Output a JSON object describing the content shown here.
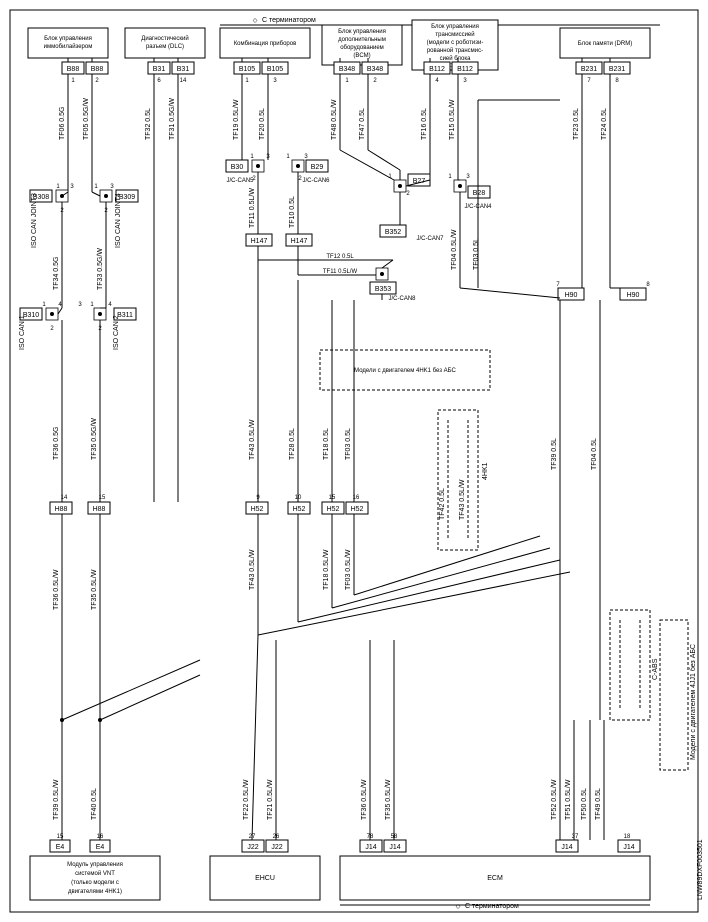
{
  "title_top": "С терминатором",
  "title_bottom": "С терминатором",
  "doc_id": "LNW89DXF003501",
  "blocks": {
    "immobilizer": {
      "line1": "Блок управления",
      "line2": "иммобилайзером"
    },
    "diag_socket": {
      "line1": "Диагностический",
      "line2": "разъем (DLC)"
    },
    "instrument": {
      "line1": "Комбинация приборов"
    },
    "bcm": {
      "line1": "Блок управления",
      "line2": "дополнительным",
      "line3": "оборудованием",
      "line4": "(BCM)"
    },
    "tcm": {
      "line1": "Блок управления",
      "line2": "трансмиссией",
      "line3": "(модели с роботизи-",
      "line4": "рованной трансмис-",
      "line5": "сией блока",
      "line6": "передач)"
    },
    "drm": {
      "line1": "Блок памяти (DRM)"
    },
    "vnt": {
      "line1": "Модуль управления",
      "line2": "системой VNT",
      "line3": "(только модели с",
      "line4": "двигателями 4HK1)"
    },
    "ehcu": "EHCU",
    "ecm": "ECM",
    "iso_can_joint3": "ISO CAN JOINT3",
    "iso_can_joint4": "ISO CAN JOINT4",
    "iso_can_1": "ISO CAN 1",
    "iso_can_2": "ISO CAN 2",
    "jc_can5": "J/C-CAN5",
    "jc_can6": "J/C-CAN6",
    "jc_can4": "J/C-CAN4",
    "jc_can7": "J/C-CAN7",
    "jc_can8": "J/C-CAN8"
  },
  "notes": {
    "4hk1_noabs": "Модели с двигателем 4HK1 без АБС",
    "4jj1_noabs": "Модели с двигателем 4JJ1 без АБС",
    "4hk1": "4HK1",
    "cabs": "С-ABS"
  },
  "connectors": {
    "B88": "B88",
    "B31": "B31",
    "B105": "B105",
    "B348": "B348",
    "B112": "B112",
    "B231": "B231",
    "B30": "B30",
    "B29": "B29",
    "B27": "B27",
    "B28": "B28",
    "B352": "B352",
    "B353": "B353",
    "B308": "B308",
    "B309": "B309",
    "B310": "B310",
    "B311": "B311",
    "H147": "H147",
    "H88": "H88",
    "H52": "H52",
    "H90": "H90",
    "E4": "E4",
    "J22": "J22",
    "J14": "J14"
  },
  "wires": {
    "TF06_05G": "TF06 0.5G",
    "TF05_05GW": "TF05 0.5G/W",
    "TF34_05G": "TF34 0.5G",
    "TF33_05GW": "TF33 0.5G/W",
    "TF36_05G": "TF36 0.5G",
    "TF35_05GW": "TF35 0.5G/W",
    "TF36_05LW": "TF36 0.5L/W",
    "TF35_05LW": "TF35 0.5L/W",
    "TF39_05LW": "TF39 0.5L/W",
    "TF40_05L": "TF40 0.5L",
    "TF32_05L": "TF32 0.5L",
    "TF31_05GW": "TF31 0.5G/W",
    "TF19_05LW": "TF19 0.5L/W",
    "TF20_05L": "TF20 0.5L",
    "TF48_05LW": "TF48 0.5L/W",
    "TF47_05L": "TF47 0.5L",
    "TF16_05L": "TF16 0.5L",
    "TF15_05LW": "TF15 0.5L/W",
    "TF23_05L": "TF23 0.5L",
    "TF24_05L": "TF24 0.5L",
    "TF11_05LW": "TF11 0.5L/W",
    "TF10_05L": "TF10 0.5L",
    "TF12_05L": "TF12 0.5L",
    "TF11_05LW2": "TF11 0.5L/W",
    "TF04_05LW": "TF04 0.5L/W",
    "TF03_05L": "TF03 0.5L",
    "TF43_05LW": "TF43 0.5L/W",
    "TF28_05L": "TF28 0.5L",
    "TF18_05L": "TF18 0.5L",
    "TF03_05L2": "TF03 0.5L",
    "TF43_05LW2": "TF43 0.5L/W",
    "TF18_05LW": "TF18 0.5L/W",
    "TF03_05LW": "TF03 0.5L/W",
    "TF42_05L": "TF42 0.5L",
    "TF43_05LW3": "TF43 0.5L/W",
    "TF39_05L": "TF39 0.5L",
    "TF04_05L": "TF04 0.5L",
    "TF52_05LW": "TF52 0.5L/W",
    "TF51_05LW": "TF51 0.5L/W",
    "TF50_05L": "TF50 0.5L",
    "TF49_05L": "TF49 0.5L",
    "TF22_05LW": "TF22 0.5L/W",
    "TF21_05LW": "TF21 0.5L/W",
    "TF36_05LW2": "TF36 0.5L/W",
    "TF35_05LW2": "TF35 0.5L/W"
  },
  "pins": {
    "1": "1",
    "2": "2",
    "3": "3",
    "4": "4",
    "5": "5",
    "6": "6",
    "7": "7",
    "8": "8",
    "9": "9",
    "10": "10",
    "14": "14",
    "15": "15",
    "16": "16",
    "18": "18",
    "26": "26",
    "27": "27",
    "37": "37",
    "58": "58",
    "78": "78"
  }
}
